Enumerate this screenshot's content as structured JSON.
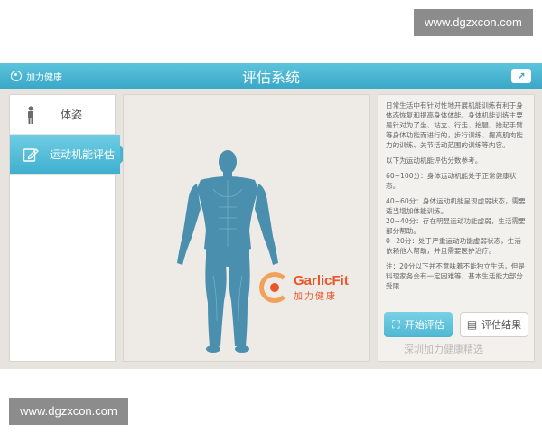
{
  "watermarks": {
    "top": "www.dgzxcon.com",
    "bottom": "www.dgzxcon.com"
  },
  "header": {
    "brand": "加力健康",
    "title": "评估系统",
    "share_icon": "share-icon"
  },
  "sidebar": {
    "items": [
      {
        "label": "体姿",
        "icon": "posture-icon",
        "active": false
      },
      {
        "label": "运动机能评估",
        "icon": "edit-icon",
        "active": true
      }
    ]
  },
  "logo": {
    "en": "GarlicFit",
    "cn": "加力健康"
  },
  "info": {
    "intro": "日常生活中有针对性地开展机能训练有利于身体态恢复和提高身体体能。身体机能训练主要是针对为了坐、站立、行走、抬腿、抬起手臂等身体功能而进行的，步行训练、提高肌肉能力的训练、关节活动范围的训练等内容。",
    "scores_title": "以下为运动机能评估分数参考。",
    "score1": "60~100分：身体运动机能处于正常健康状态。",
    "score2": "40~60分：身体运动机能呈现虚弱状态，需要适当增加体能训练。",
    "score3": "20~40分：存在明显运动功能虚弱，生活需要部分帮助。",
    "score4": "0~20分：处于严重运动功能虚弱状态，生活依赖他人帮助，并且需要医护治疗。",
    "note": "注：20分以下并不意味着不能独立生活，但是料理家务会有一定困难等，基本生活能力部分受限"
  },
  "buttons": {
    "start": "开始评估",
    "result": "评估结果"
  },
  "footer_watermark": "深圳加力健康精选",
  "colors": {
    "accent": "#3aa8c8",
    "figure": "#4a8fae",
    "brand": "#e8562a"
  }
}
